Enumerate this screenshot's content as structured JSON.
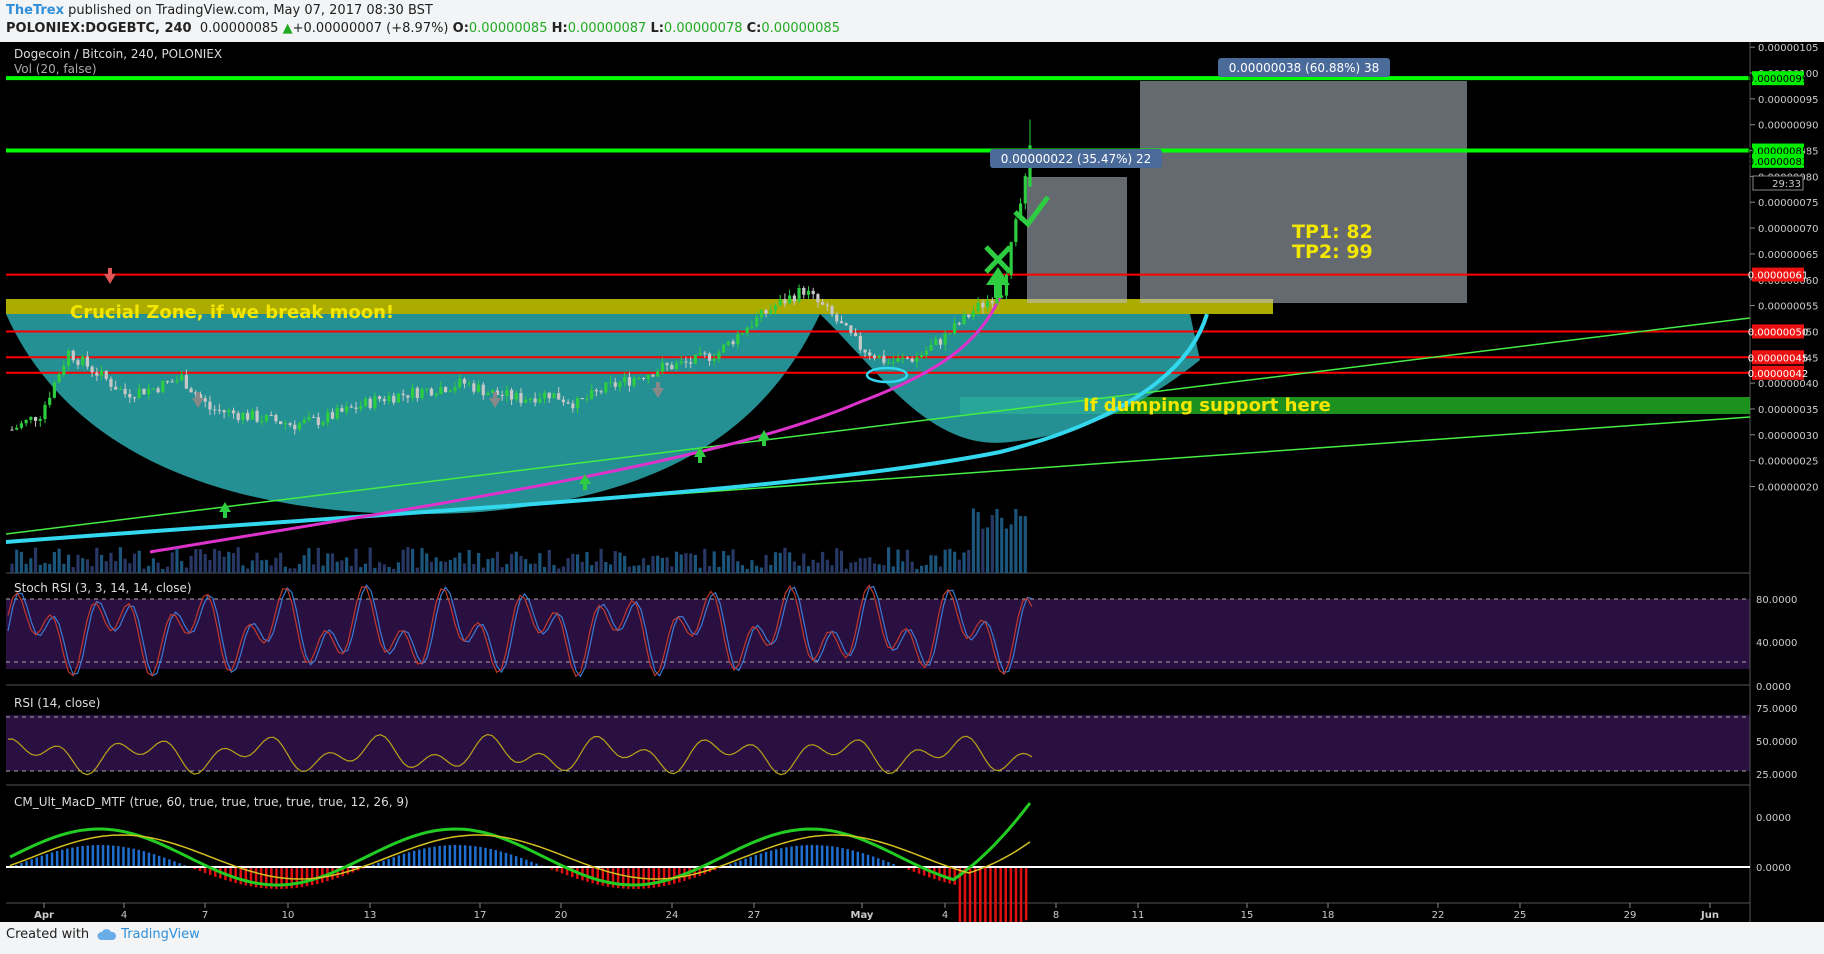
{
  "header": {
    "author": "TheTrex",
    "published": " published on TradingView.com, May 07, 2017 08:30 BST",
    "symbol": "POLONIEX:DOGEBTC, 240",
    "last": "0.00000085",
    "change_arrow": "▲",
    "change": "+0.00000007 (+8.97%)",
    "o_label": "O:",
    "o": "0.00000085",
    "h_label": "H:",
    "h": "0.00000087",
    "l_label": "L:",
    "l": "0.00000078",
    "c_label": "C:",
    "c": "0.00000085"
  },
  "footer": {
    "created": "Created with",
    "brand": "TradingView",
    "brand_icon": "cloud-icon"
  },
  "chart_data": {
    "type": "candlestick",
    "title": "Dogecoin / Bitcoin, 240, POLONIEX",
    "volume_label": "Vol (20, false)",
    "ylim": [
      1.7e-07,
      1.06e-06
    ],
    "y_ticks": [
      "0.00000020",
      "0.00000025",
      "0.00000030",
      "0.00000035",
      "0.00000040",
      "0.00000045",
      "0.00000050",
      "0.00000055",
      "0.00000060",
      "0.00000065",
      "0.00000070",
      "0.00000075",
      "0.00000080",
      "0.00000085",
      "0.00000090",
      "0.00000095",
      "0.00000100",
      "0.00000105"
    ],
    "x_ticks": [
      "Apr",
      "4",
      "7",
      "10",
      "13",
      "17",
      "20",
      "24",
      "27",
      "May",
      "4",
      "8",
      "11",
      "15",
      "18",
      "22",
      "25",
      "29",
      "Jun"
    ],
    "price_series": [
      [
        "Apr 01",
        3.1e-07
      ],
      [
        "Apr 02",
        3.4e-07
      ],
      [
        "Apr 03",
        4.6e-07
      ],
      [
        "Apr 04",
        4.2e-07
      ],
      [
        "Apr 05",
        3.8e-07
      ],
      [
        "Apr 06",
        3.9e-07
      ],
      [
        "Apr 07",
        4.1e-07
      ],
      [
        "Apr 08",
        3.5e-07
      ],
      [
        "Apr 09",
        3.4e-07
      ],
      [
        "Apr 10",
        3.3e-07
      ],
      [
        "Apr 11",
        3.2e-07
      ],
      [
        "Apr 12",
        3.3e-07
      ],
      [
        "Apr 13",
        3.5e-07
      ],
      [
        "Apr 14",
        3.7e-07
      ],
      [
        "Apr 15",
        3.8e-07
      ],
      [
        "Apr 16",
        3.9e-07
      ],
      [
        "Apr 17",
        4e-07
      ],
      [
        "Apr 18",
        3.8e-07
      ],
      [
        "Apr 19",
        3.7e-07
      ],
      [
        "Apr 20",
        3.8e-07
      ],
      [
        "Apr 21",
        3.6e-07
      ],
      [
        "Apr 22",
        3.9e-07
      ],
      [
        "Apr 23",
        4.1e-07
      ],
      [
        "Apr 24",
        4.3e-07
      ],
      [
        "Apr 25",
        4.4e-07
      ],
      [
        "Apr 26",
        4.6e-07
      ],
      [
        "Apr 27",
        5.1e-07
      ],
      [
        "Apr 28",
        5.5e-07
      ],
      [
        "Apr 29",
        5.8e-07
      ],
      [
        "Apr 30",
        5.3e-07
      ],
      [
        "May 01",
        4.7e-07
      ],
      [
        "May 02",
        4.4e-07
      ],
      [
        "May 03",
        4.5e-07
      ],
      [
        "May 04",
        4.9e-07
      ],
      [
        "May 05",
        5.4e-07
      ],
      [
        "May 06",
        5.8e-07
      ],
      [
        "May 07",
        8.3e-07
      ]
    ],
    "horizontal_levels": [
      {
        "value": 9.9e-07,
        "color": "#00ff00",
        "label": "0.00000099"
      },
      {
        "value": 8.5e-07,
        "color": "#00ff00",
        "label": "0.00000085"
      },
      {
        "value": 6.1e-07,
        "color": "#ff0000",
        "label": "0.00000061"
      },
      {
        "value": 5e-07,
        "color": "#ff0000",
        "label": "0.00000050"
      },
      {
        "value": 4.5e-07,
        "color": "#ff0000",
        "label": "0.00000045"
      },
      {
        "value": 4.2e-07,
        "color": "#ff0000",
        "label": "0.00000042"
      }
    ],
    "price_tags": [
      {
        "value": 8.3e-07,
        "label": "0.00000083"
      }
    ],
    "countdown": "29:33",
    "measure_labels": [
      "0.00000038 (60.88%) 38",
      "0.00000022 (35.47%) 22"
    ],
    "annotations": [
      "Crucial Zone, if we break moon!",
      "If dumping support here",
      "TP1: 82",
      "TP2: 99"
    ],
    "indicators": [
      {
        "label": "Stoch RSI (3, 3, 14, 14, close)",
        "ticks": [
          "80.0000",
          "40.0000",
          "0.0000"
        ],
        "levels": [
          80,
          20
        ]
      },
      {
        "label": "RSI (14, close)",
        "ticks": [
          "75.0000",
          "50.0000",
          "25.0000"
        ],
        "levels": [
          70,
          30
        ]
      },
      {
        "label": "CM_Ult_MacD_MTF (true, 60, true, true, true, true, true, 12, 26, 9)",
        "ticks": [
          "0.0000",
          "0.0000"
        ]
      }
    ],
    "colors": {
      "background": "#000000",
      "up": "#2ecc40",
      "down": "#c0c0c0",
      "level_green": "#00ff00",
      "level_red": "#ff2020",
      "cup": "#2fb2b5",
      "arc": "#33d7ee",
      "annotation": "#f3e600"
    }
  }
}
